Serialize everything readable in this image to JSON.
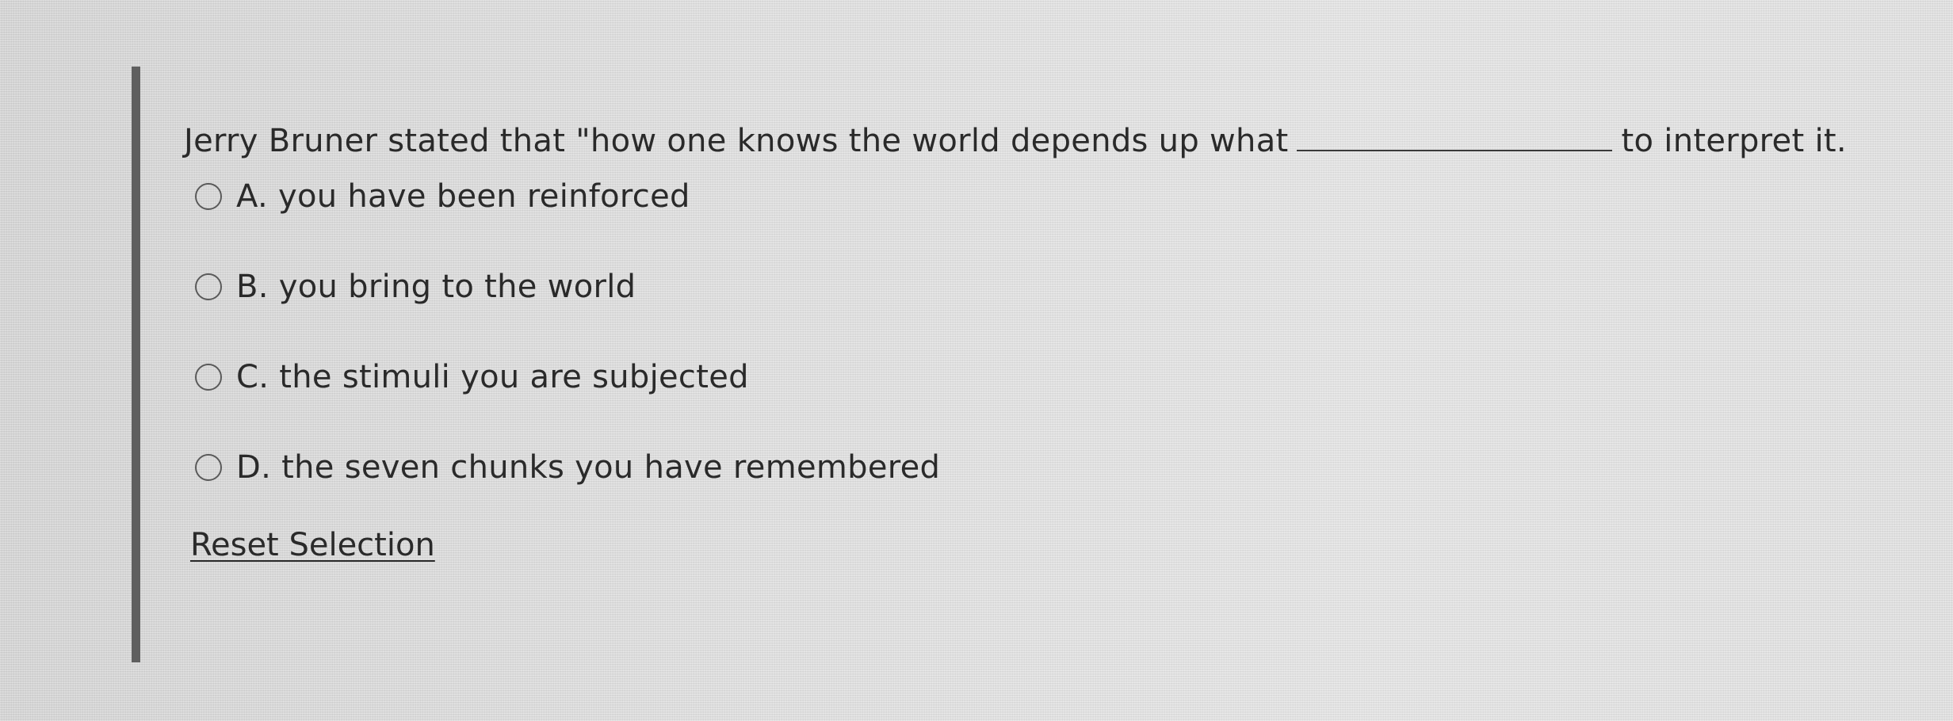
{
  "question": {
    "stem_before": "Jerry Bruner stated that \"how one knows the world depends up what",
    "stem_after": "to interpret it."
  },
  "options": [
    {
      "label": "A. you have been reinforced",
      "selected": false
    },
    {
      "label": "B. you bring to the world",
      "selected": false
    },
    {
      "label": "C. the stimuli you are subjected",
      "selected": false
    },
    {
      "label": "D. the seven chunks you have remembered",
      "selected": false
    }
  ],
  "reset_label": "Reset Selection",
  "colors": {
    "accent_bar": "#5f5f5f",
    "text": "#2a2a2a",
    "background": "#dcdcdc"
  }
}
